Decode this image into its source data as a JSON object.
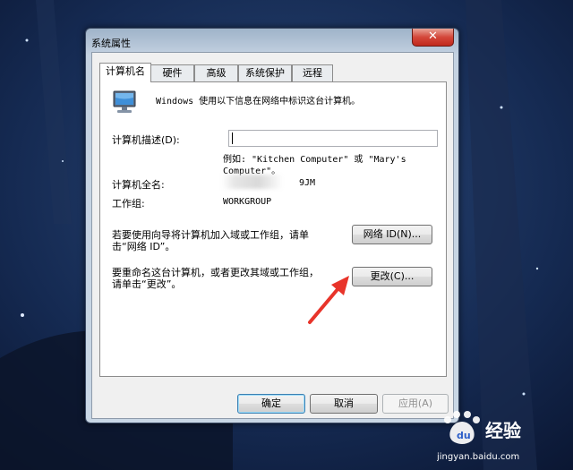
{
  "window": {
    "title": "系统属性",
    "close_label": "✕"
  },
  "tabs": [
    {
      "label": "计算机名",
      "active": true
    },
    {
      "label": "硬件",
      "active": false
    },
    {
      "label": "高级",
      "active": false
    },
    {
      "label": "系统保护",
      "active": false
    },
    {
      "label": "远程",
      "active": false
    }
  ],
  "panel": {
    "intro": "Windows 使用以下信息在网络中标识这台计算机。",
    "description_label": "计算机描述(D):",
    "description_value": "",
    "example_line1": "例如: \"Kitchen Computer\" 或 \"Mary's",
    "example_line2": "Computer\"。",
    "full_name_label": "计算机全名:",
    "full_name_suffix": "9JM",
    "workgroup_label": "工作组:",
    "workgroup_value": "WORKGROUP",
    "network_id_text_line1": "若要使用向导将计算机加入域或工作组，请单",
    "network_id_text_line2": "击“网络 ID”。",
    "network_id_button": "网络 ID(N)...",
    "rename_text_line1": "要重命名这台计算机，或者更改其域或工作组，",
    "rename_text_line2": "请单击“更改”。",
    "change_button": "更改(C)..."
  },
  "footer": {
    "ok": "确定",
    "cancel": "取消",
    "apply": "应用(A)"
  },
  "watermark": {
    "brand": "Baidu",
    "brand_cn": "经验",
    "url": "jingyan.baidu.com"
  },
  "colors": {
    "annotation_arrow": "#e8342a",
    "close_button": "#c8372a"
  }
}
